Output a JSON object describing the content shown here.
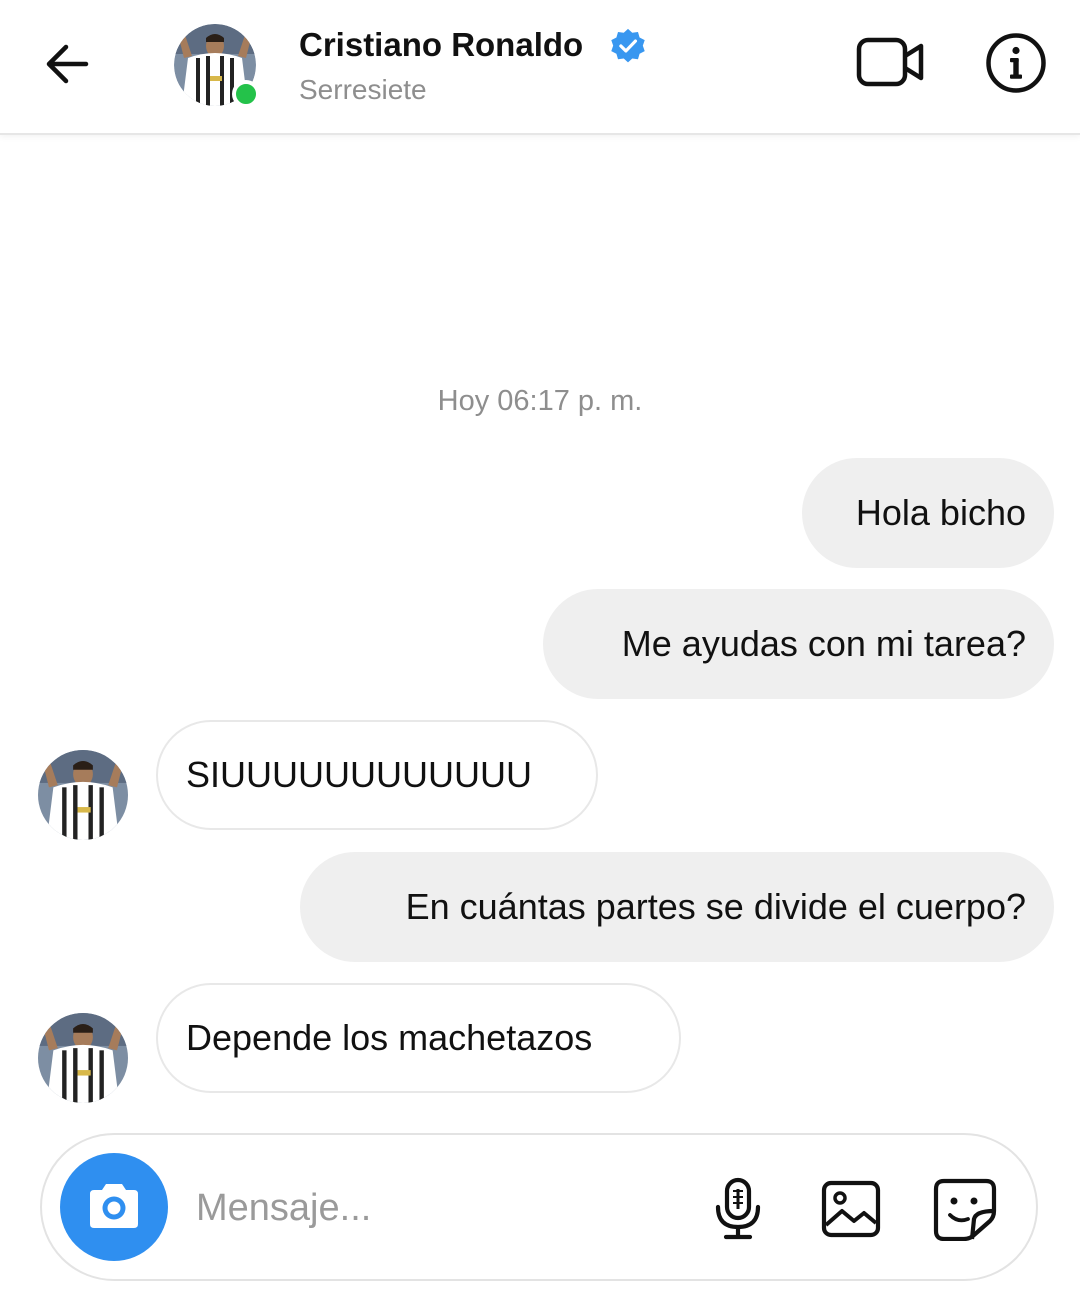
{
  "header": {
    "contact_name": "Cristiano Ronaldo",
    "contact_status": "Serresiete",
    "verified": true,
    "online": true,
    "icons": {
      "back": "back-arrow-icon",
      "video": "video-call-icon",
      "info": "info-icon",
      "verified": "verified-badge-icon"
    }
  },
  "conversation": {
    "timestamp": "Hoy 06:17 p. m.",
    "messages": [
      {
        "direction": "outgoing",
        "text": "Hola bicho"
      },
      {
        "direction": "outgoing",
        "text": "Me ayudas con mi tarea?"
      },
      {
        "direction": "incoming",
        "text": "SIUUUUUUUUUUUU"
      },
      {
        "direction": "outgoing",
        "text": "En cuántas partes se divide el cuerpo?"
      },
      {
        "direction": "incoming",
        "text": "Depende los machetazos"
      }
    ]
  },
  "composer": {
    "placeholder": "Mensaje...",
    "icons": {
      "camera": "camera-icon",
      "microphone": "microphone-icon",
      "gallery": "gallery-icon",
      "sticker": "sticker-icon"
    }
  },
  "colors": {
    "online_dot": "#24c24a",
    "verified_badge": "#3897f0",
    "camera_button": "#2f8ff0",
    "outgoing_bubble": "#efefef",
    "incoming_bubble_border": "#e8e8e8"
  }
}
